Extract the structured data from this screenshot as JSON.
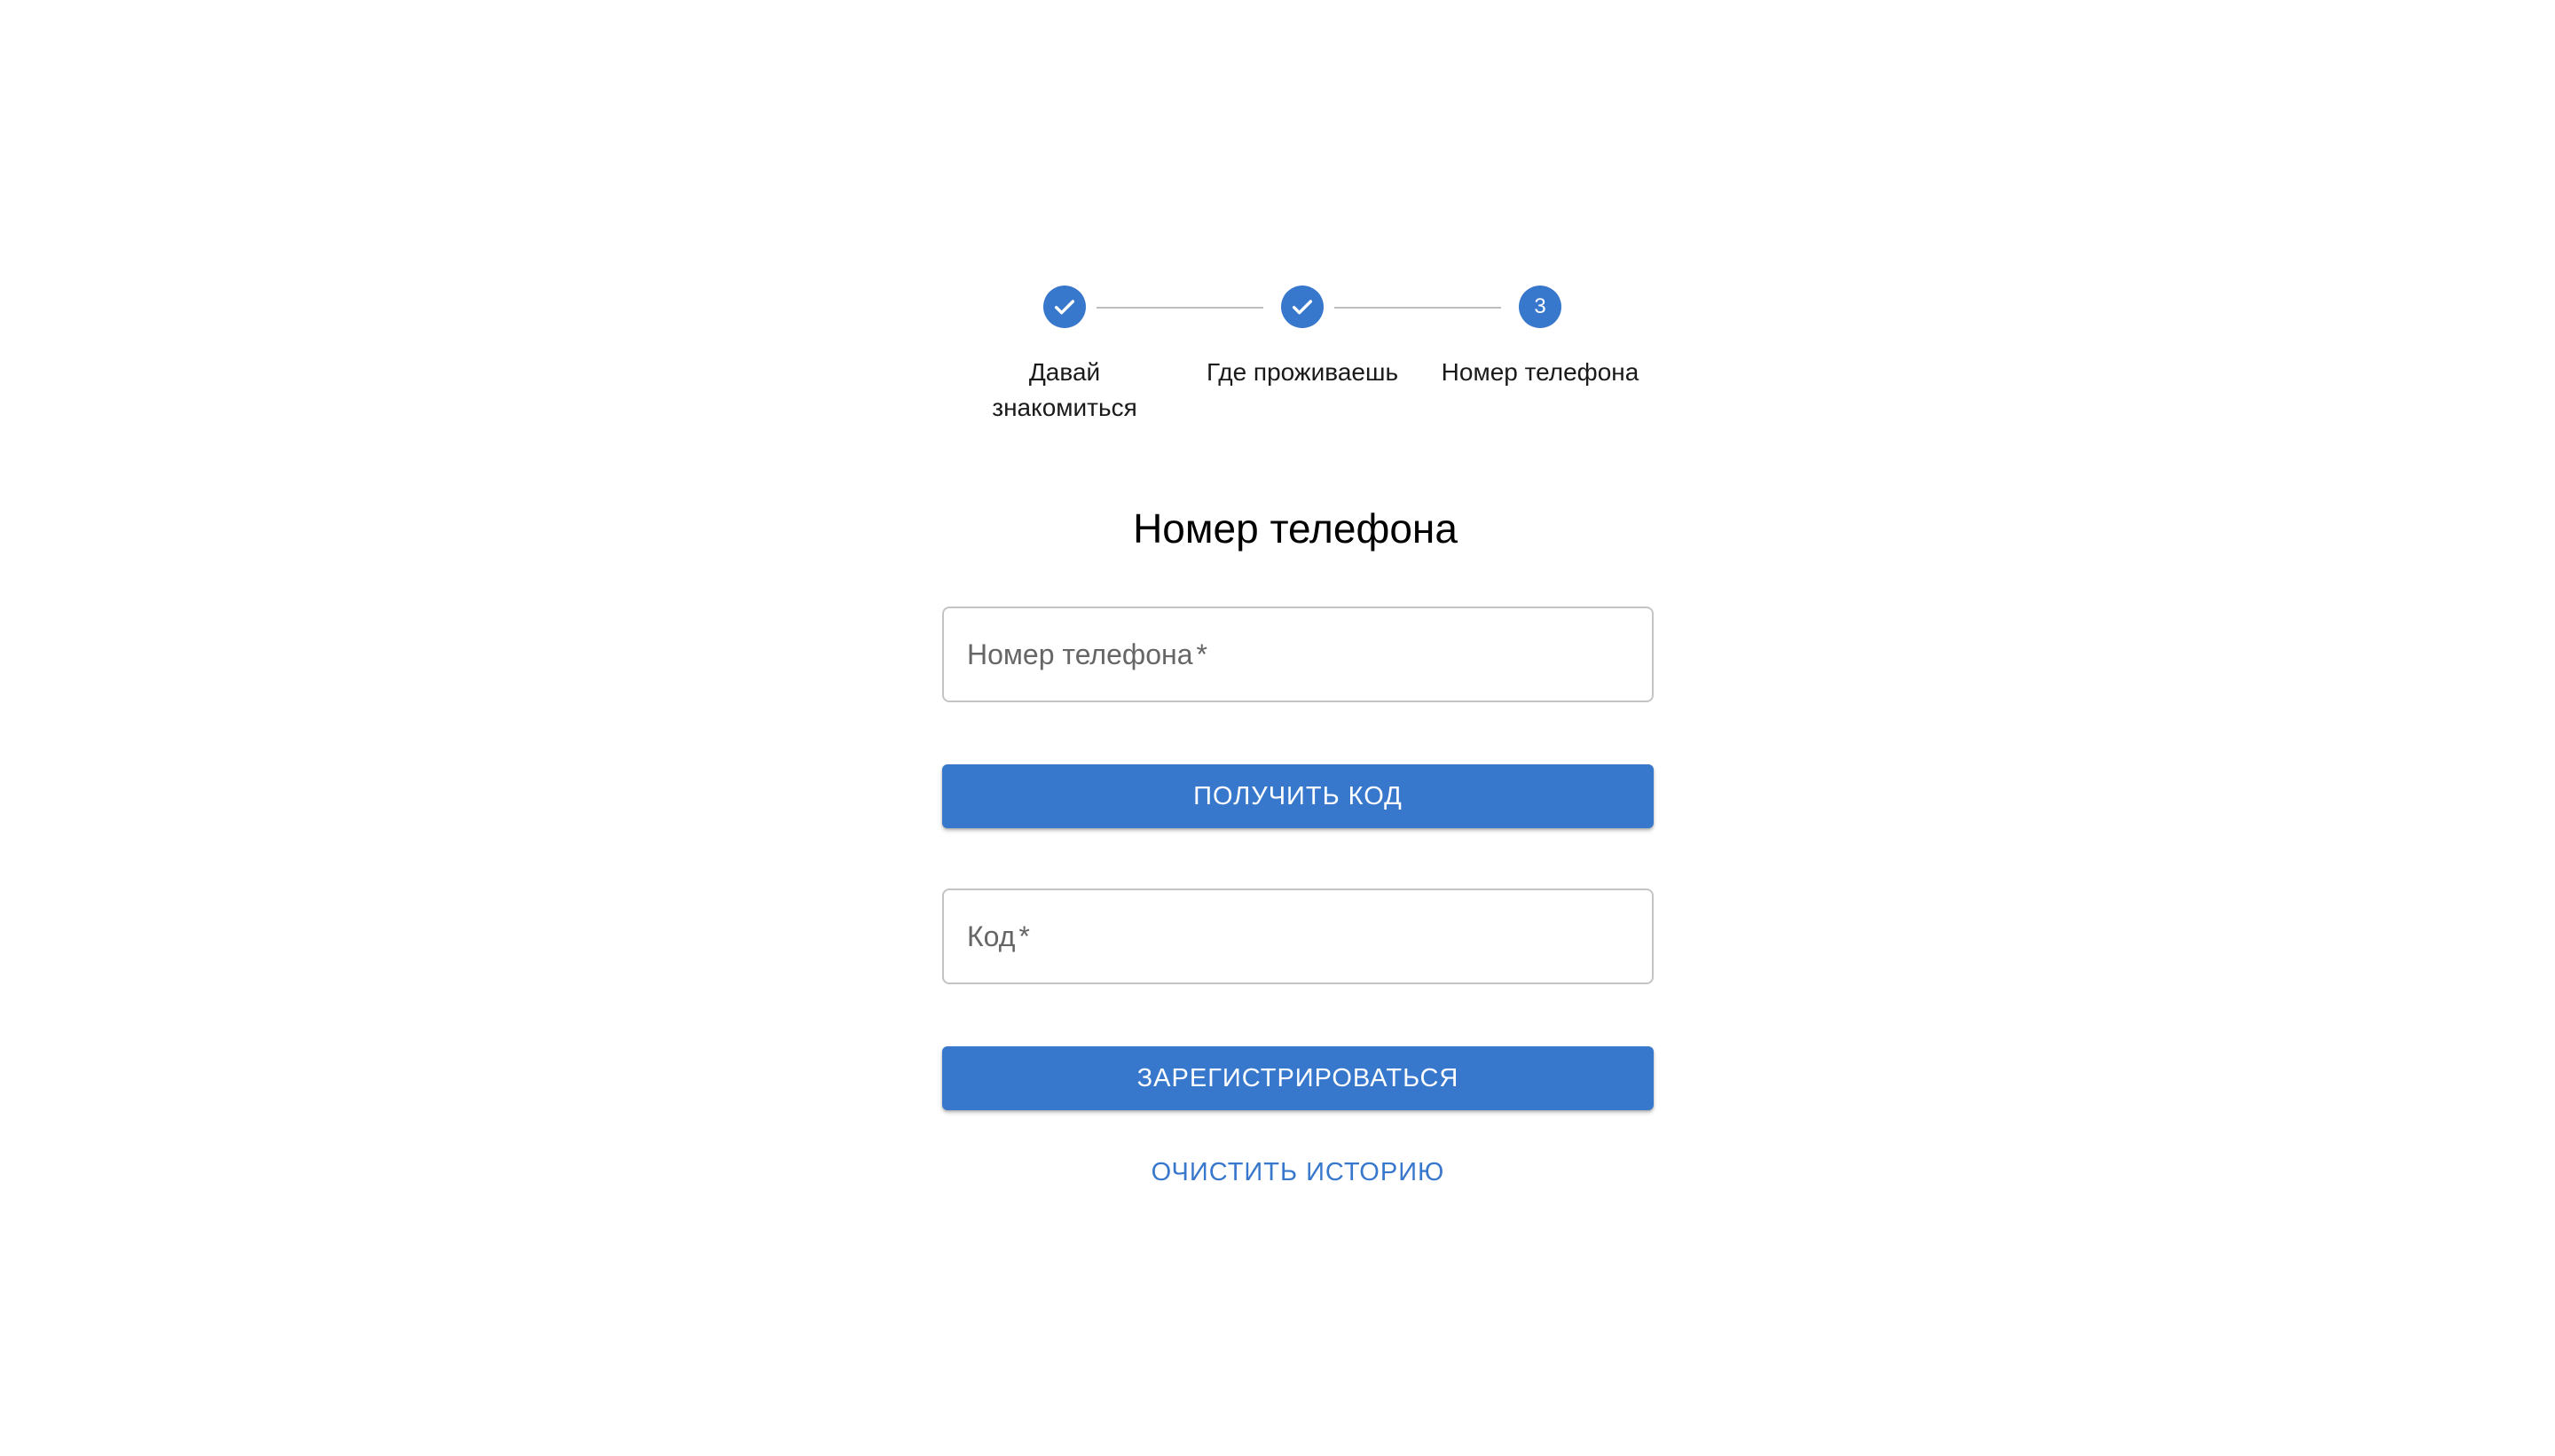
{
  "accent_color": "#3777cc",
  "stepper": {
    "steps": [
      {
        "label_line1": "Давай",
        "label_line2": "знакомиться",
        "state": "completed",
        "icon": "check-icon"
      },
      {
        "label": "Где проживаешь",
        "state": "completed",
        "icon": "check-icon"
      },
      {
        "label": "Номер телефона",
        "state": "active",
        "number": "3"
      }
    ]
  },
  "form": {
    "title": "Номер телефона",
    "phone_field": {
      "label": "Номер телефона",
      "required_mark": "*",
      "value": ""
    },
    "get_code_button": "ПОЛУЧИТЬ КОД",
    "code_field": {
      "label": "Код",
      "required_mark": "*",
      "value": ""
    },
    "register_button": "ЗАРЕГИСТРИРОВАТЬСЯ",
    "clear_history_link": "ОЧИСТИТЬ ИСТОРИЮ"
  }
}
